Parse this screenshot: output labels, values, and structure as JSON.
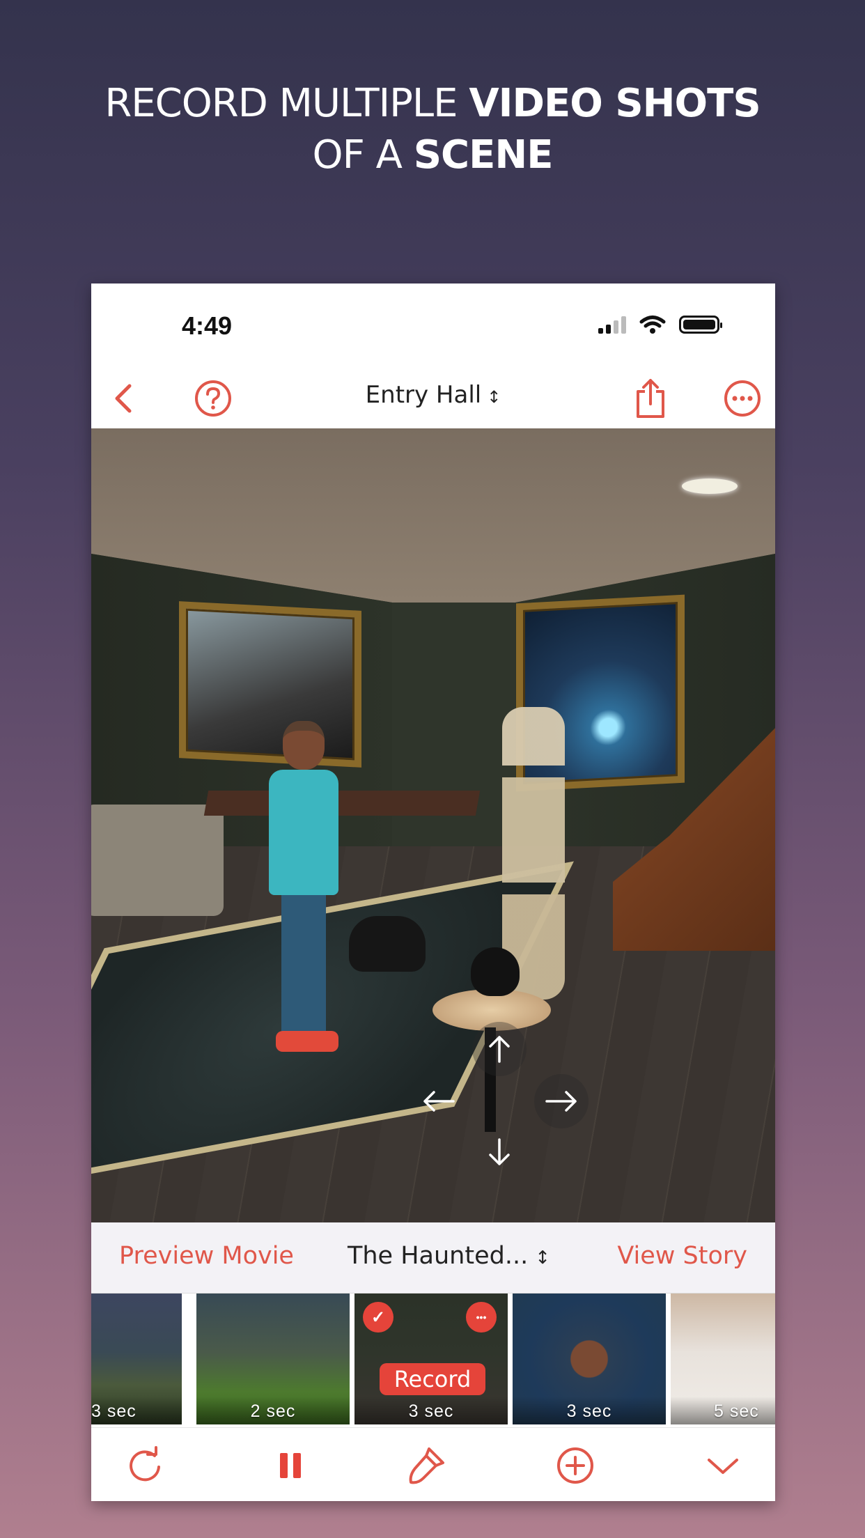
{
  "headline": {
    "line1_regular": "RECORD MULTIPLE ",
    "line1_bold": "VIDEO SHOTS",
    "line2_regular": "OF A ",
    "line2_bold": "SCENE"
  },
  "status_bar": {
    "time": "4:49",
    "signal_bars_active": 2,
    "signal_bars_total": 4,
    "wifi_icon": "wifi-icon",
    "battery_icon": "battery-full-icon"
  },
  "nav": {
    "back_icon": "chevron-left-icon",
    "help_icon": "question-circle-icon",
    "title": "Entry Hall",
    "title_chevron": "⌃⌄",
    "share_icon": "share-icon",
    "more_icon": "ellipsis-circle-icon"
  },
  "scene": {
    "description": "3D haunted entry hall scene with character, skeleton, black cat, crow, portraits and staircase",
    "dpad": {
      "up": "↑",
      "down": "↓",
      "left": "←",
      "right": "→"
    }
  },
  "story_bar": {
    "preview_label": "Preview Movie",
    "story_title": "The Haunted...",
    "story_chevron": "⌃⌄",
    "view_label": "View Story"
  },
  "shots": [
    {
      "duration": "3 sec",
      "selected": false
    },
    {
      "duration": "2 sec",
      "selected": false
    },
    {
      "duration": "3 sec",
      "selected": true,
      "record_label": "Record",
      "check_badge": "✓",
      "more_badge": "•••"
    },
    {
      "duration": "3 sec",
      "selected": false
    },
    {
      "duration": "5 sec",
      "selected": false
    }
  ],
  "toolbar": {
    "items": [
      {
        "name": "redo-icon"
      },
      {
        "name": "pause-icon"
      },
      {
        "name": "paintbrush-icon"
      },
      {
        "name": "add-circle-icon"
      },
      {
        "name": "chevron-down-icon"
      }
    ]
  },
  "colors": {
    "accent": "#e0574a",
    "record": "#e5443a",
    "storybar_bg": "#f3f2f6"
  }
}
